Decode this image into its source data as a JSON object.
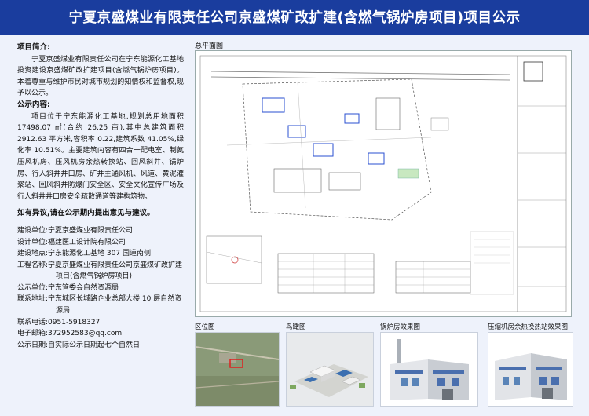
{
  "header": {
    "title": "宁夏京盛煤业有限责任公司京盛煤矿改扩建(含燃气锅炉房项目)项目公示"
  },
  "intro": {
    "title": "项目简介:",
    "text": "宁夏京盛煤业有限责任公司在宁东能源化工基地投资建设京盛煤矿改扩建项目(含燃气锅炉房项目)。本着尊重与维护市民对城市规划的知情权和监督权,现予以公示。"
  },
  "content": {
    "title": "公示内容:",
    "text": "项目位于宁东能源化工基地,规划总用地面积 17498.07 ㎡(合约 26.25 亩),其中总建筑面积 2912.63 平方米,容积率 0.22,建筑系数 41.05%,绿化率 10.51%。主要建筑内容有四合一配电室、制氮压风机房、压风机房余热转换站、回风斜井、锅炉房、行人斜井井口房、矿井主通风机、风道、黄泥灌浆站、回风斜井防爆门安全区、安全文化宣传广场及行人斜井井口房安全疏散通道等建构筑物。"
  },
  "feedback": "如有异议,请在公示期内提出意见与建议。",
  "contacts": [
    {
      "label": "建设单位:",
      "value": "宁夏京盛煤业有限责任公司"
    },
    {
      "label": "设计单位:",
      "value": "福建医工设计院有限公司"
    },
    {
      "label": "建设地点:",
      "value": "宁东能源化工基地 307 国道南侧"
    },
    {
      "label": "工程名称:",
      "value": "宁夏京盛煤业有限责任公司京盛煤矿改扩建项目(含燃气锅炉房项目)"
    },
    {
      "label": "公示单位:",
      "value": "宁东管委会自然资源局"
    },
    {
      "label": "联系地址:",
      "value": "宁东城区长城路企业总部大楼 10 层自然资源局"
    },
    {
      "label": "联系电话:",
      "value": "0951-5918327"
    },
    {
      "label": "电子邮箱:",
      "value": "372952583@qq.com"
    },
    {
      "label": "公示日期:",
      "value": "自实际公示日期起七个自然日"
    }
  ],
  "images": {
    "plan_title": "总平面图",
    "location_title": "区位图",
    "aerial_title": "鸟瞰图",
    "boiler_title": "锅炉房效果图",
    "compressor_title": "压缩机房余热换热站效果图"
  },
  "colors": {
    "header_bg": "#1a3d9e",
    "page_bg": "#eef2fb"
  }
}
